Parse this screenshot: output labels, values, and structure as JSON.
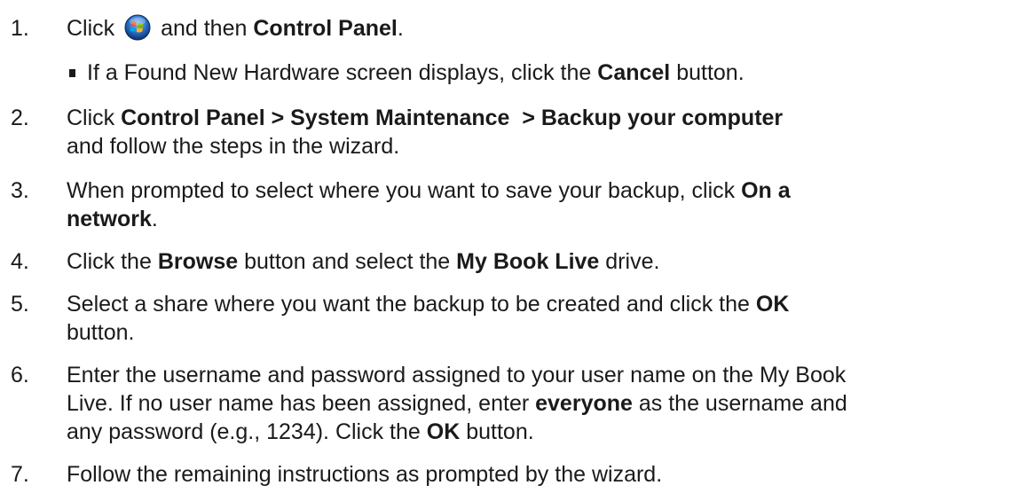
{
  "steps": [
    {
      "num": "1.",
      "pre": "Click",
      "mid": "and then",
      "bold": "Control Panel",
      "end": "."
    },
    {
      "sub": {
        "pre": "If a Found New Hardware screen displays, click the",
        "bold": "Cancel",
        "post": "button."
      }
    },
    {
      "num": "2.",
      "pre": "Click",
      "bold": "Control Panel > System Maintenance  > Backup your computer",
      "line2": "and follow the steps in the wizard."
    },
    {
      "num": "3.",
      "pre": "When prompted to select where you want to save your backup, click",
      "bold_a": "On a",
      "bold_b": "network",
      "end": "."
    },
    {
      "num": "4.",
      "pre": "Click the",
      "bold1": "Browse",
      "mid": "button and select the",
      "bold2": "My Book Live",
      "end": "drive."
    },
    {
      "num": "5.",
      "pre": "Select a share where you want the backup to be created and click the",
      "bold": "OK",
      "line2": "button."
    },
    {
      "num": "6.",
      "line1": "Enter the username and password assigned to your user name on the My Book",
      "line2_pre": "Live. If no user name has been assigned, enter",
      "line2_bold": "everyone",
      "line2_post": "as the username and",
      "line3_pre": "any password (e.g., 1234). Click the",
      "line3_bold": "OK",
      "line3_post": "button."
    },
    {
      "num": "7.",
      "text": "Follow the remaining instructions as prompted by the wizard."
    }
  ],
  "icons": {
    "start": "windows-start-orb-icon"
  },
  "colors": {
    "text": "#1a1a1a",
    "orb_blue": "#2a6fc9"
  }
}
